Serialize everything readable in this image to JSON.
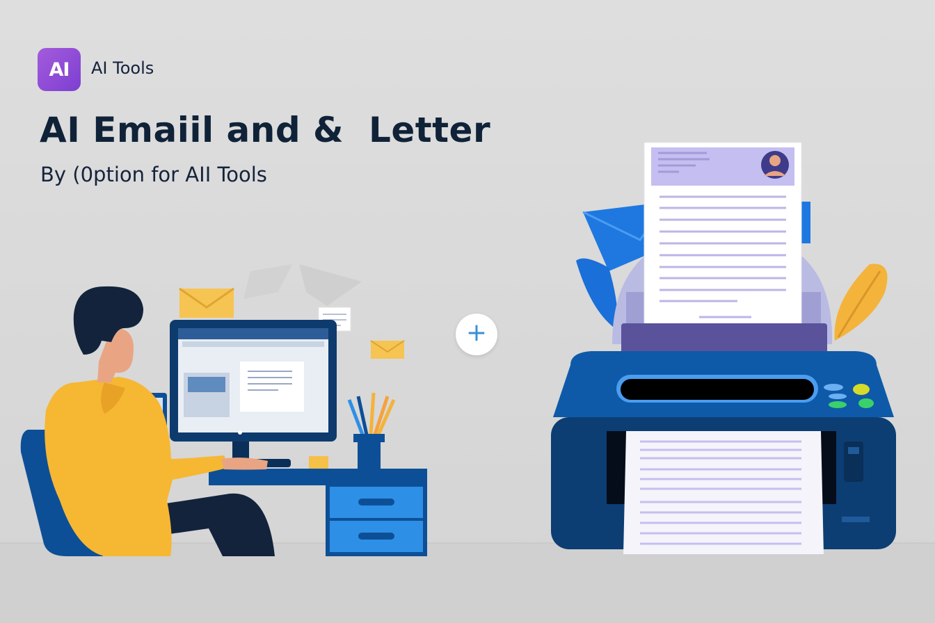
{
  "brand": {
    "logo_text": "AI",
    "name": "AI Tools"
  },
  "hero": {
    "title": "AI Emaiil and &  Letter",
    "subtitle": "By (0ption for AII Tools"
  },
  "plus_button": {
    "symbol": "+"
  },
  "colors": {
    "logo_purple": "#8a4ad6",
    "navy": "#0f2238",
    "printer_blue": "#0c4a8a",
    "hoodie_yellow": "#f4b33a",
    "accent_blue": "#2e8fe6"
  },
  "icons": [
    "envelope-icon",
    "plus-icon",
    "pencil-cup-icon",
    "leaf-icon",
    "avatar-icon"
  ]
}
